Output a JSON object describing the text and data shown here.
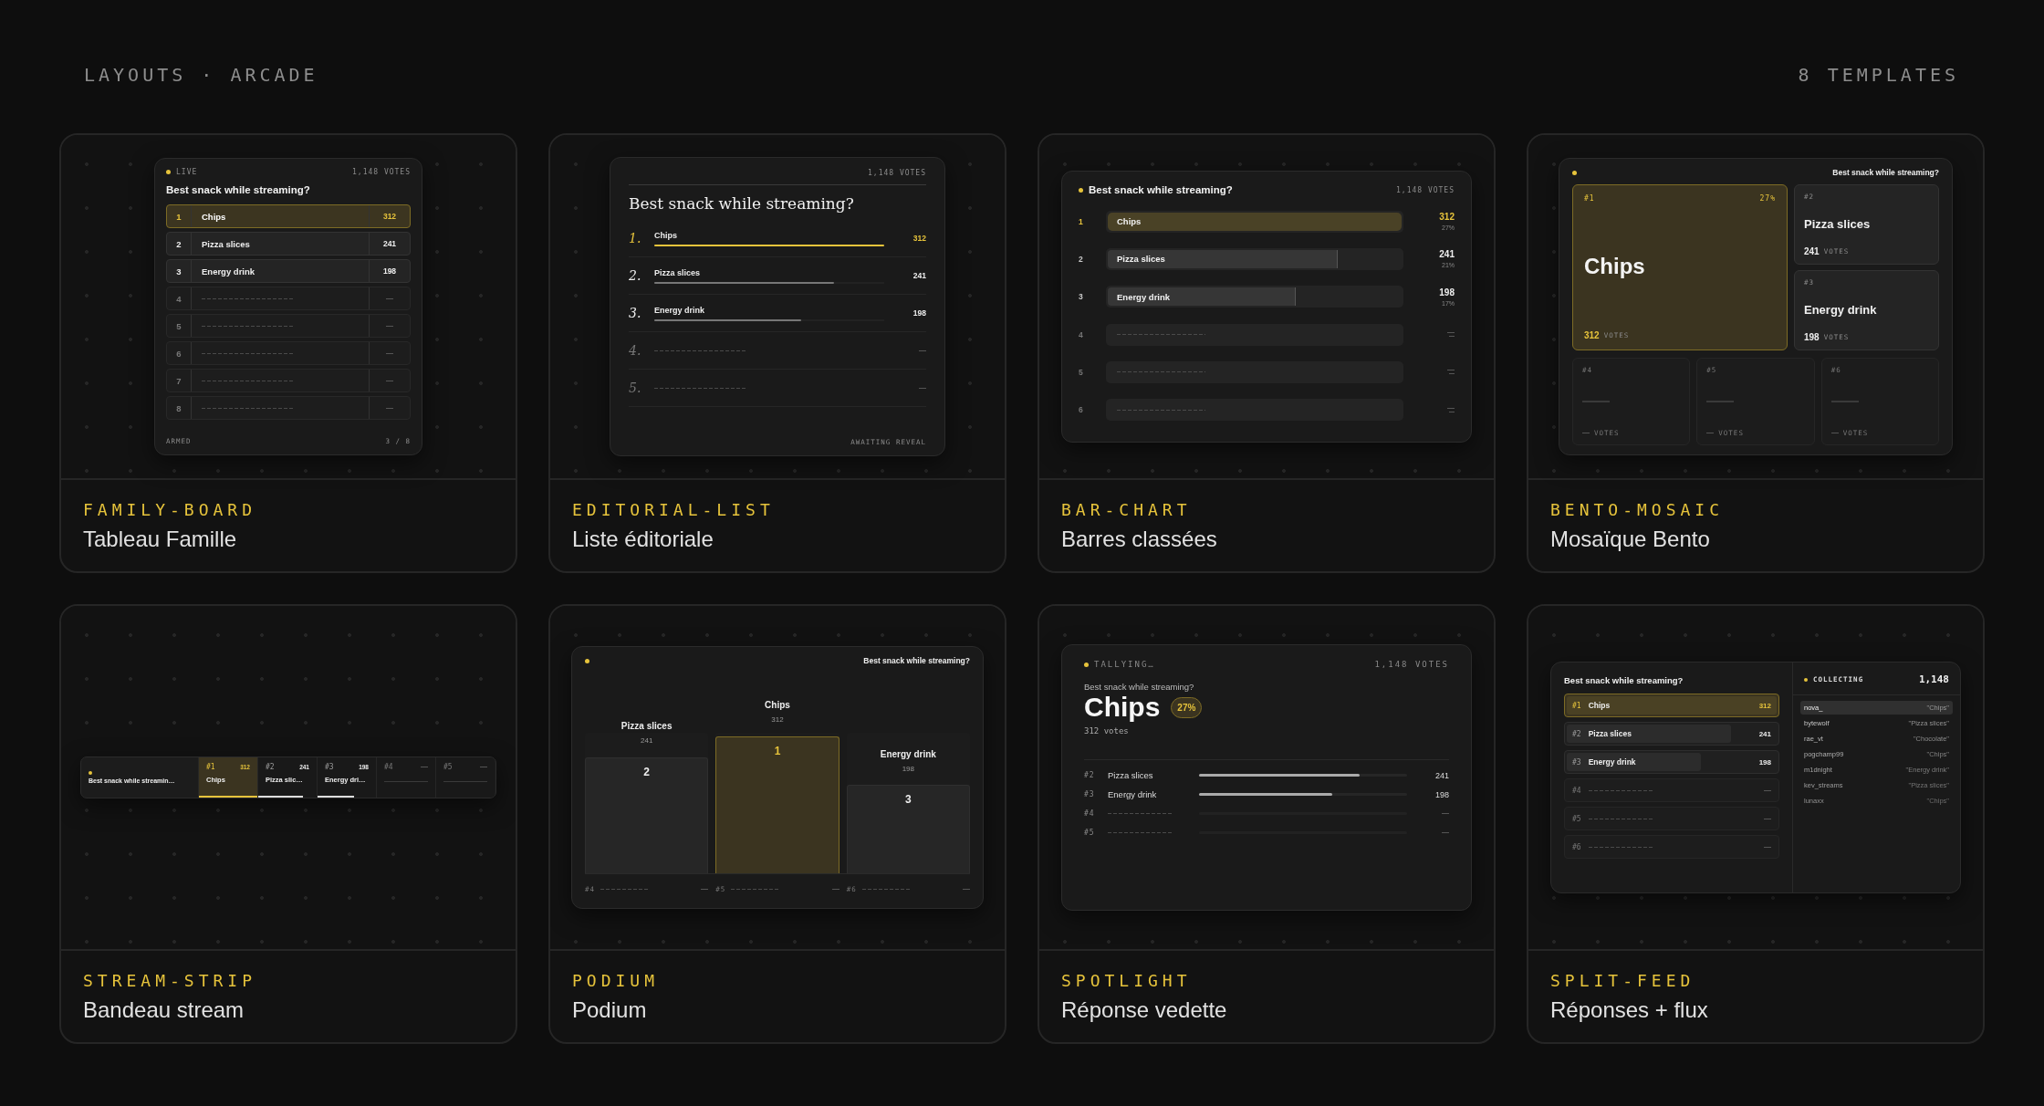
{
  "header": {
    "title": "LAYOUTS · ARCADE",
    "count": "8 TEMPLATES"
  },
  "templates": [
    {
      "kind": "family-board",
      "slug": "FAMILY-BOARD",
      "name": "Tableau Famille",
      "preview": {
        "status": "LIVE",
        "votes": "1,148 VOTES",
        "question": "Best snack while streaming?",
        "rows": [
          {
            "kind": "answer",
            "rank": "1",
            "label": "Chips",
            "count": "312",
            "selected": true
          },
          {
            "kind": "answer",
            "rank": "2",
            "label": "Pizza slices",
            "count": "241",
            "selected": false
          },
          {
            "kind": "answer",
            "rank": "3",
            "label": "Energy drink",
            "count": "198",
            "selected": false
          },
          {
            "kind": "empty",
            "rank": "4"
          },
          {
            "kind": "empty",
            "rank": "5"
          },
          {
            "kind": "empty",
            "rank": "6"
          },
          {
            "kind": "empty",
            "rank": "7"
          },
          {
            "kind": "empty",
            "rank": "8"
          }
        ],
        "footer_left": "ARMED",
        "footer_right": "3 / 8"
      }
    },
    {
      "kind": "editorial-list",
      "slug": "EDITORIAL-LIST",
      "name": "Liste éditoriale",
      "preview": {
        "votes": "1,148 VOTES",
        "question": "Best snack while streaming?",
        "rows": [
          {
            "kind": "answer",
            "rank": "1.",
            "label": "Chips",
            "count": "312",
            "level": 1,
            "selected": true
          },
          {
            "kind": "answer",
            "rank": "2.",
            "label": "Pizza slices",
            "count": "241",
            "level": 0.78,
            "selected": false
          },
          {
            "kind": "answer",
            "rank": "3.",
            "label": "Energy drink",
            "count": "198",
            "level": 0.64,
            "selected": false
          },
          {
            "kind": "empty",
            "rank": "4."
          },
          {
            "kind": "empty",
            "rank": "5."
          }
        ],
        "footer": "AWAITING REVEAL"
      }
    },
    {
      "kind": "bar-chart",
      "slug": "BAR-CHART",
      "name": "Barres classées",
      "preview": {
        "question": "Best snack while streaming?",
        "votes": "1,148 VOTES",
        "rows": [
          {
            "kind": "answer",
            "rank": "1",
            "label": "Chips",
            "count": "312",
            "percent": "27%",
            "level": 1,
            "selected": true
          },
          {
            "kind": "answer",
            "rank": "2",
            "label": "Pizza slices",
            "count": "241",
            "percent": "21%",
            "level": 0.77,
            "selected": false
          },
          {
            "kind": "answer",
            "rank": "3",
            "label": "Energy drink",
            "count": "198",
            "percent": "17%",
            "level": 0.63,
            "selected": false
          },
          {
            "kind": "empty",
            "rank": "4"
          },
          {
            "kind": "empty",
            "rank": "5"
          },
          {
            "kind": "empty",
            "rank": "6"
          }
        ]
      }
    },
    {
      "kind": "bento-mosaic",
      "slug": "BENTO-MOSAIC",
      "name": "Mosaïque Bento",
      "preview": {
        "question": "Best snack while streaming?",
        "leader": {
          "rank": "#1",
          "percent": "27%",
          "label": "Chips",
          "count": "312",
          "unit": "VOTES"
        },
        "tiles": [
          {
            "kind": "answer",
            "rank": "#2",
            "label": "Pizza slices",
            "count": "241",
            "unit": "VOTES"
          },
          {
            "kind": "answer",
            "rank": "#3",
            "label": "Energy drink",
            "count": "198",
            "unit": "VOTES"
          },
          {
            "kind": "empty",
            "rank": "#4",
            "unit": "VOTES"
          },
          {
            "kind": "empty",
            "rank": "#5",
            "unit": "VOTES"
          },
          {
            "kind": "empty",
            "rank": "#6",
            "unit": "VOTES"
          }
        ]
      }
    },
    {
      "kind": "stream-strip",
      "slug": "STREAM-STRIP",
      "name": "Bandeau stream",
      "preview": {
        "question": "Best snack while streamin…",
        "cells": [
          {
            "kind": "answer",
            "rank": "#1",
            "count": "312",
            "label": "Chips",
            "level": 1,
            "selected": true
          },
          {
            "kind": "answer",
            "rank": "#2",
            "count": "241",
            "label": "Pizza slic…",
            "level": 0.77,
            "selected": false
          },
          {
            "kind": "answer",
            "rank": "#3",
            "count": "198",
            "label": "Energy dri…",
            "level": 0.63,
            "selected": false
          },
          {
            "kind": "empty",
            "rank": "#4"
          },
          {
            "kind": "empty",
            "rank": "#5"
          }
        ]
      }
    },
    {
      "kind": "podium",
      "slug": "PODIUM",
      "name": "Podium",
      "preview": {
        "question": "Best snack while streaming?",
        "places": [
          {
            "rank": "2",
            "label": "Pizza slices",
            "count": "241",
            "level": 0.85,
            "selected": false
          },
          {
            "rank": "1",
            "label": "Chips",
            "count": "312",
            "level": 1,
            "selected": true
          },
          {
            "rank": "3",
            "label": "Energy drink",
            "count": "198",
            "level": 0.65,
            "selected": false
          }
        ],
        "others": [
          {
            "rank": "#4"
          },
          {
            "rank": "#5"
          },
          {
            "rank": "#6"
          }
        ]
      }
    },
    {
      "kind": "spotlight",
      "slug": "SPOTLIGHT",
      "name": "Réponse vedette",
      "preview": {
        "status": "TALLYING…",
        "votes": "1,148 VOTES",
        "question": "Best snack while streaming?",
        "leader": {
          "label": "Chips",
          "percent": "27%",
          "count": "312 votes"
        },
        "rows": [
          {
            "kind": "answer",
            "rank": "#2",
            "label": "Pizza slices",
            "count": "241",
            "level": 0.77
          },
          {
            "kind": "answer",
            "rank": "#3",
            "label": "Energy drink",
            "count": "198",
            "level": 0.64
          },
          {
            "kind": "empty",
            "rank": "#4"
          },
          {
            "kind": "empty",
            "rank": "#5"
          }
        ]
      }
    },
    {
      "kind": "split-feed",
      "slug": "SPLIT-FEED",
      "name": "Réponses + flux",
      "preview": {
        "question": "Best snack while streaming?",
        "rows": [
          {
            "kind": "answer",
            "rank": "#1",
            "label": "Chips",
            "count": "312",
            "level": 1,
            "selected": true
          },
          {
            "kind": "answer",
            "rank": "#2",
            "label": "Pizza slices",
            "count": "241",
            "level": 0.77,
            "selected": false
          },
          {
            "kind": "answer",
            "rank": "#3",
            "label": "Energy drink",
            "count": "198",
            "level": 0.63,
            "selected": false
          },
          {
            "kind": "empty",
            "rank": "#4"
          },
          {
            "kind": "empty",
            "rank": "#5"
          },
          {
            "kind": "empty",
            "rank": "#6"
          }
        ],
        "status": "COLLECTING",
        "total": "1,148",
        "feed": [
          {
            "user": "nova_",
            "answer": "\"Chips\"",
            "selected": true
          },
          {
            "user": "bytewolf",
            "answer": "\"Pizza slices\"",
            "selected": false
          },
          {
            "user": "rae_vt",
            "answer": "\"Chocolate\"",
            "selected": false
          },
          {
            "user": "pogchamp99",
            "answer": "\"Chips\"",
            "selected": false
          },
          {
            "user": "m1dnight",
            "answer": "\"Energy drink\"",
            "selected": false
          },
          {
            "user": "kev_streams",
            "answer": "\"Pizza slices\"",
            "selected": false
          },
          {
            "user": "lunaxx",
            "answer": "\"Chips\"",
            "selected": false
          }
        ]
      }
    }
  ]
}
